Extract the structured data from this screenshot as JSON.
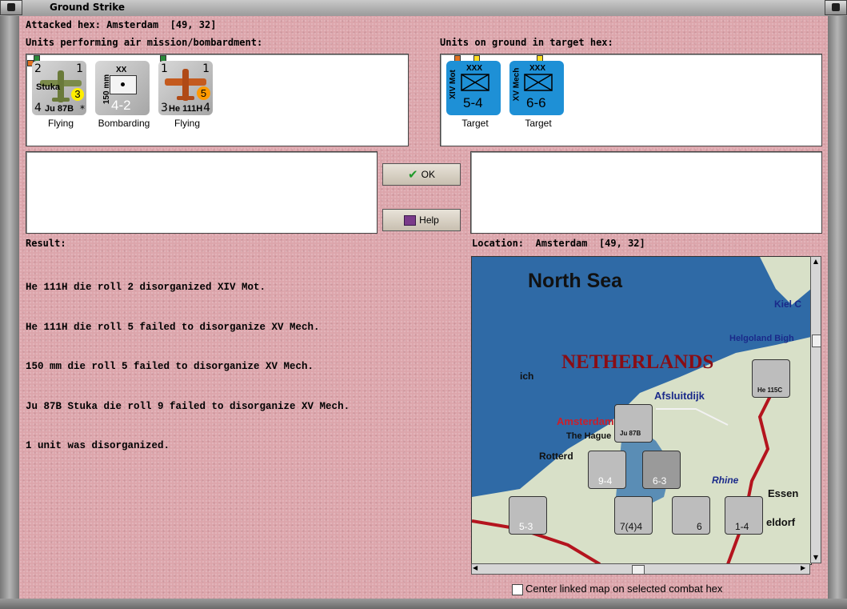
{
  "window": {
    "title": "Ground Strike"
  },
  "header": {
    "attacked_hex": "Attacked hex: Amsterdam  [49, 32]"
  },
  "air_units": {
    "label": "Units performing air mission/bombardment:",
    "units": [
      {
        "name": "Stuka",
        "type": "Ju 87B",
        "top_left": "2",
        "top_right": "1",
        "bottom_left": "4",
        "bottom_right": "*",
        "badge": "3",
        "badge_color": "#ffee00",
        "status": "Flying"
      },
      {
        "name": "150 mm",
        "type": "XX",
        "value": "4-2",
        "status": "Bombarding"
      },
      {
        "name": "He 111H",
        "type": "He 111H",
        "top_left": "1",
        "top_right": "1",
        "bottom_left": "3",
        "bottom_right": "4",
        "badge": "5",
        "badge_color": "#ff9900",
        "status": "Flying"
      }
    ]
  },
  "ground_units": {
    "label": "Units on ground in target hex:",
    "units": [
      {
        "name": "XIV Mot",
        "size": "XXX",
        "value": "5-4",
        "status": "Target"
      },
      {
        "name": "XV Mech",
        "size": "XXX",
        "value": "6-6",
        "status": "Target"
      }
    ]
  },
  "buttons": {
    "ok": "OK",
    "help": "Help"
  },
  "result": {
    "label": "Result:",
    "lines": [
      "He 111H die roll 2 disorganized XIV Mot.",
      "He 111H die roll 5 failed to disorganize XV Mech.",
      "150 mm die roll 5 failed to disorganize XV Mech.",
      "Ju 87B Stuka die roll 9 failed to disorganize XV Mech.",
      "1 unit was disorganized."
    ]
  },
  "location": {
    "label": "Location:  Amsterdam  [49, 32]"
  },
  "map": {
    "labels": {
      "north_sea": "North Sea",
      "netherlands": "NETHERLANDS",
      "afsluitdijk": "Afsluitdijk",
      "amsterdam": "Amsterdam",
      "the_hague": "The Hague",
      "rotterdam": "Rotterd",
      "rhine": "Rhine",
      "essen": "Essen",
      "kiel": "Kiel C",
      "helgoland": "Helgoland Bigh",
      "dorf": "eldorf",
      "ich": "ich"
    },
    "counters": [
      {
        "text": "9-4"
      },
      {
        "text": "6-3"
      },
      {
        "text": "7(4)4"
      },
      {
        "text": "5-3"
      },
      {
        "text": "1-4"
      },
      {
        "text": "6"
      },
      {
        "text": "Ju 87B"
      },
      {
        "text": "He 115C"
      }
    ]
  },
  "options": {
    "center_map": "Center linked map on selected combat hex"
  },
  "colors": {
    "dialog_bg": "#dca5ab",
    "counter_blue": "#1e90d6",
    "map_sea": "#2f6aa6",
    "map_land": "#d8e0c8",
    "border_red": "#b4141e"
  }
}
